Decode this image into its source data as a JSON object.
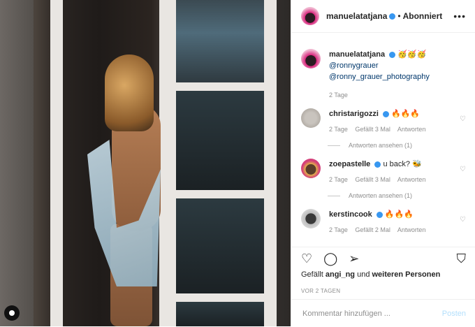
{
  "header": {
    "username": "manuelatatjana",
    "separator": "•",
    "follow_label": "Abonniert",
    "more_icon": "more-horizontal-icon"
  },
  "caption": {
    "username": "manuelatatjana",
    "emoji": "🥳🥳🥳",
    "mention1": "@ronnygrauer",
    "mention2": "@ronny_grauer_photography",
    "time": "2 Tage"
  },
  "comments": [
    {
      "username": "christarigozzi",
      "text": "🔥🔥🔥",
      "time": "2 Tage",
      "likes": "Gefällt 3 Mal",
      "reply": "Antworten",
      "replies": "Antworten ansehen (1)"
    },
    {
      "username": "zoepastelle",
      "text": "u back? 🐝",
      "time": "2 Tage",
      "likes": "Gefällt 3 Mal",
      "reply": "Antworten",
      "replies": "Antworten ansehen (1)"
    },
    {
      "username": "kerstincook",
      "text": "🔥🔥🔥",
      "time": "2 Tage",
      "likes": "Gefällt 2 Mal",
      "reply": "Antworten"
    }
  ],
  "actions": {
    "likes_prefix": "Gefällt ",
    "likes_user": "angi_ng",
    "likes_middle": " und ",
    "likes_suffix": "weiteren Personen",
    "posted_ago": "VOR 2 TAGEN"
  },
  "composer": {
    "placeholder": "Kommentar hinzufügen ...",
    "post_label": "Posten"
  },
  "colors": {
    "link": "#00376b",
    "verified": "#3897f0",
    "post_disabled": "#b2dffc"
  }
}
